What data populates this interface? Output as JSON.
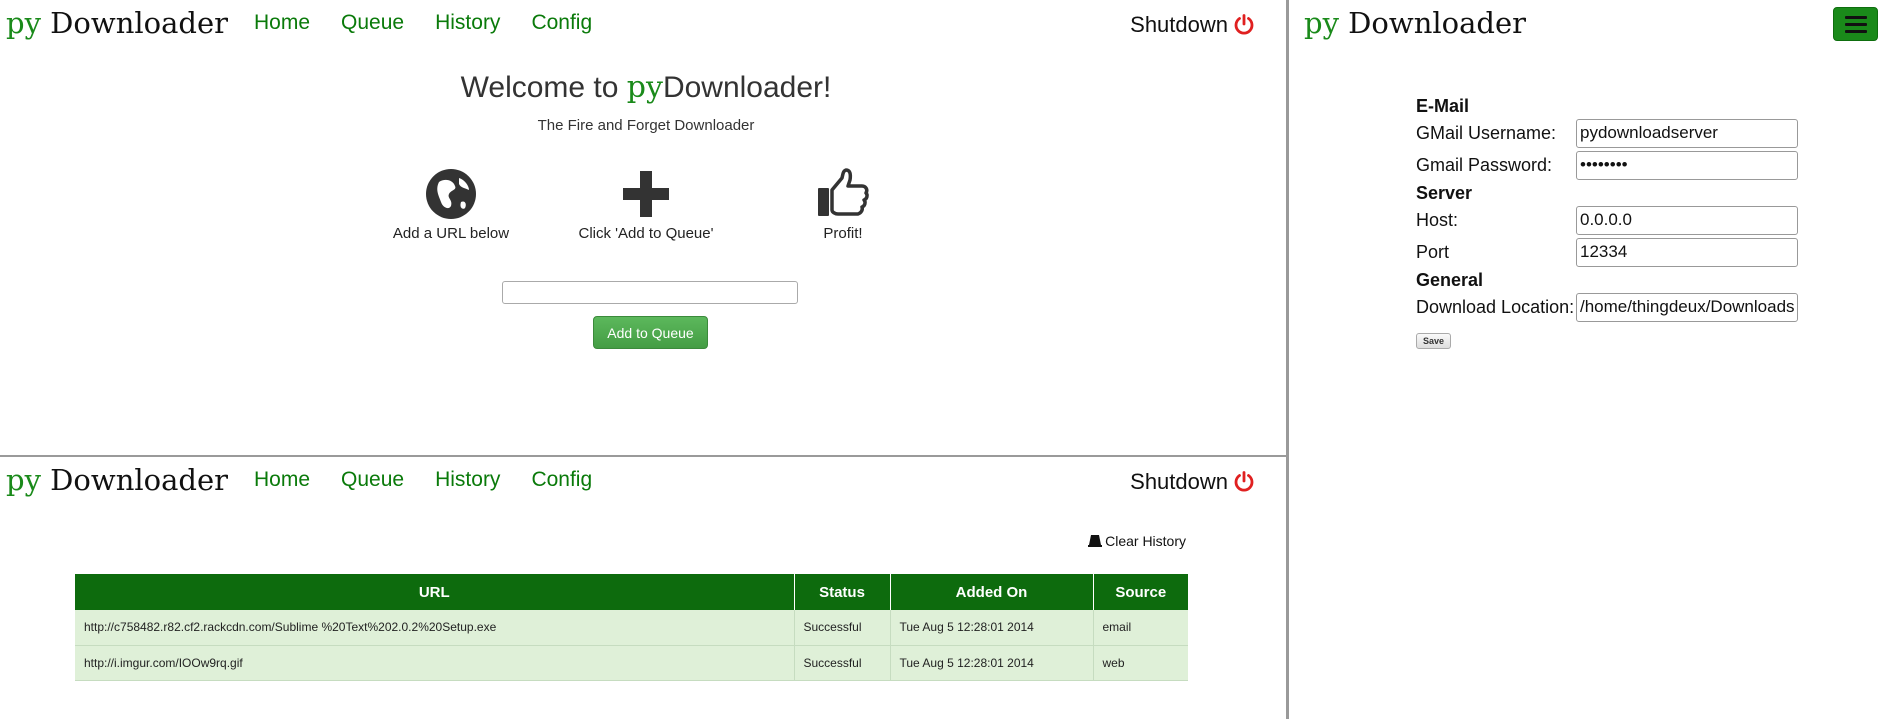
{
  "brand": {
    "prefix": "py",
    "name": "Downloader"
  },
  "nav": [
    "Home",
    "Queue",
    "History",
    "Config"
  ],
  "shutdown_label": "Shutdown",
  "colors": {
    "accent": "#0a7a0a",
    "table_header": "#0d6b0d",
    "row_bg": "#dff0d8",
    "shutdown": "#e02020"
  },
  "home": {
    "welcome_pre": "Welcome to ",
    "welcome_post": "!",
    "tagline": "The Fire and Forget Downloader",
    "steps": [
      {
        "icon": "globe-icon",
        "label": "Add a URL below"
      },
      {
        "icon": "plus-icon",
        "label": "Click 'Add to Queue'"
      },
      {
        "icon": "thumbs-up-icon",
        "label": "Profit!"
      }
    ],
    "url_value": "",
    "add_button": "Add to Queue"
  },
  "history": {
    "clear_label": "Clear History",
    "columns": [
      "URL",
      "Status",
      "Added On",
      "Source"
    ],
    "rows": [
      {
        "url": "http://c758482.r82.cf2.rackcdn.com/Sublime %20Text%202.0.2%20Setup.exe",
        "status": "Successful",
        "added_on": "Tue Aug 5 12:28:01 2014",
        "source": "email"
      },
      {
        "url": "http://i.imgur.com/IOOw9rq.gif",
        "status": "Successful",
        "added_on": "Tue Aug 5 12:28:01 2014",
        "source": "web"
      }
    ]
  },
  "config": {
    "email_section": "E-Mail",
    "gmail_username_label": "GMail Username:",
    "gmail_username_value": "pydownloadserver",
    "gmail_password_label": "Gmail Password:",
    "gmail_password_value": "••••••••",
    "server_section": "Server",
    "host_label": "Host:",
    "host_value": "0.0.0.0",
    "port_label": "Port",
    "port_value": "12334",
    "general_section": "General",
    "download_location_label": "Download Location:",
    "download_location_value": "/home/thingdeux/Downloads",
    "save_button": "Save"
  }
}
